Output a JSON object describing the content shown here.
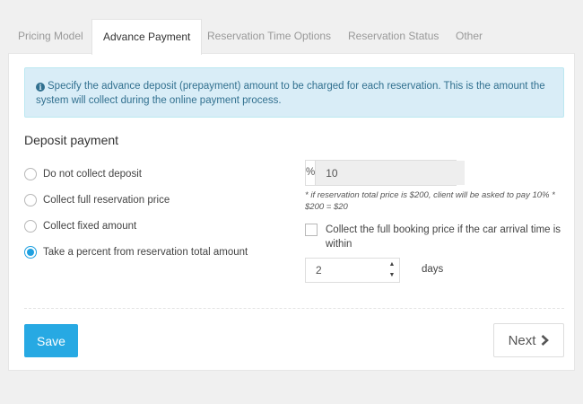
{
  "tabs": [
    {
      "label": "Pricing Model"
    },
    {
      "label": "Advance Payment"
    },
    {
      "label": "Reservation Time Options"
    },
    {
      "label": "Reservation Status"
    },
    {
      "label": "Other"
    }
  ],
  "active_tab": "Advance Payment",
  "info": {
    "icon": "info-circle-icon",
    "text": "Specify the advance deposit (prepayment) amount to be charged for each reservation. This is the amount the system will collect during the online payment process."
  },
  "deposit": {
    "title": "Deposit payment",
    "options": [
      {
        "label": "Do not collect deposit",
        "checked": false
      },
      {
        "label": "Collect full reservation price",
        "checked": false
      },
      {
        "label": "Collect fixed amount",
        "checked": false
      },
      {
        "label": "Take a percent from reservation total amount",
        "checked": true
      }
    ],
    "percent_addon": "%",
    "percent_value": "10",
    "hint": "* if reservation total price is $200, client will be asked to pay 10% * $200 = $20",
    "full_price_label": "Collect the full booking price if the car arrival time is within",
    "full_price_checked": false,
    "days_value": "2",
    "days_label": "days"
  },
  "actions": {
    "save_label": "Save",
    "next_label": "Next"
  },
  "colors": {
    "primary": "#27a9e3",
    "info_bg": "#d9edf7",
    "info_text": "#31708f"
  }
}
